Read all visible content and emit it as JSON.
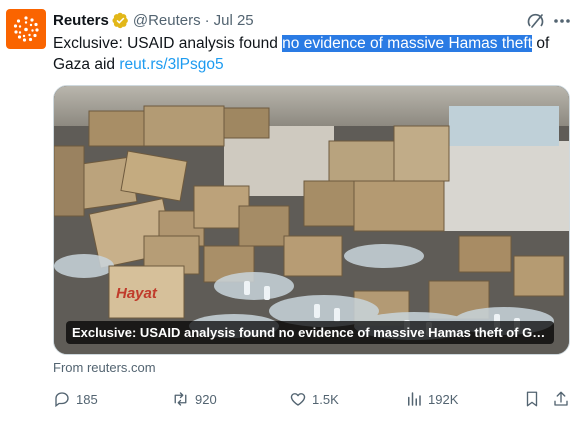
{
  "author": {
    "display_name": "Reuters",
    "handle": "@Reuters",
    "separator": "·",
    "time": "Jul 25",
    "avatar_color": "#fa6400",
    "verified_badge_color": "#e2b719",
    "icons": {
      "grok": "grok-icon",
      "more": "more-icon"
    }
  },
  "tweet": {
    "text_before": "Exclusive: USAID analysis found ",
    "text_highlight": "no evidence of massive Hamas theft",
    "text_after": " of Gaza aid ",
    "link": "reut.rs/3lPsgo5",
    "highlight_color": "#2a7be4",
    "link_color": "#1d9bf0"
  },
  "media": {
    "caption": "Exclusive: USAID analysis found no evidence of massive Hamas theft of Gaza ...",
    "box_print": "Hayat",
    "source": "From reuters.com"
  },
  "actions": {
    "reply_count": "185",
    "repost_count": "920",
    "like_count": "1.5K",
    "view_count": "192K",
    "icons": [
      "reply-icon",
      "repost-icon",
      "like-icon",
      "views-icon",
      "bookmark-icon",
      "share-icon"
    ]
  }
}
